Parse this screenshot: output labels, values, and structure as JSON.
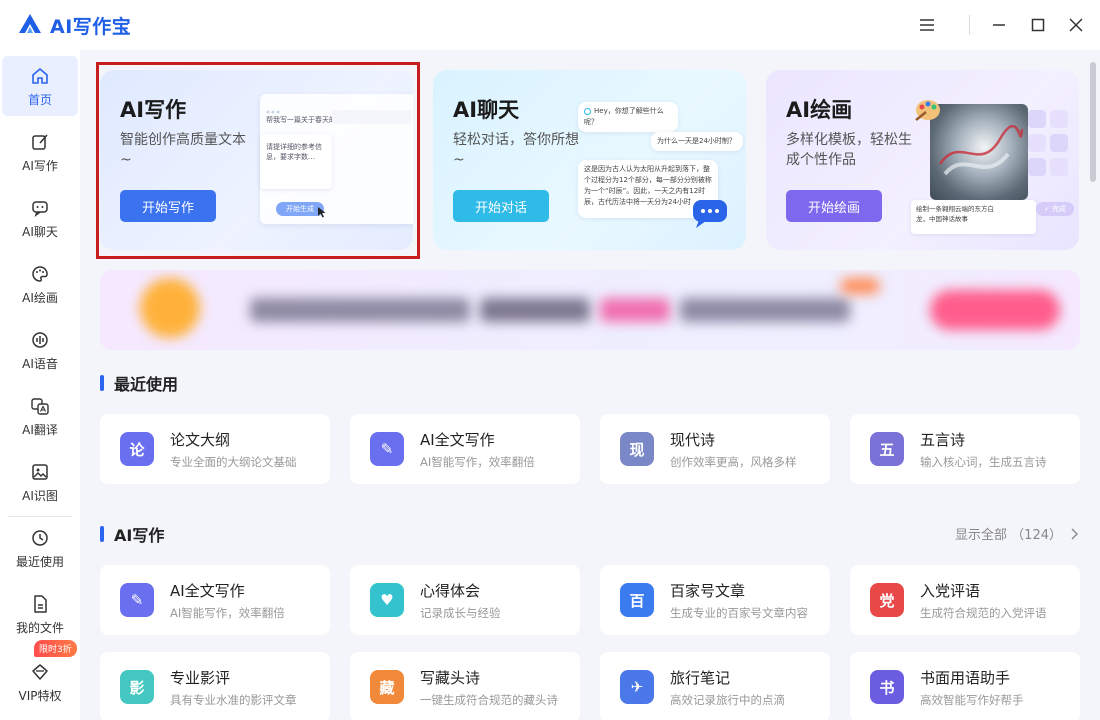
{
  "app": {
    "title": "AI写作宝"
  },
  "window_controls": [
    "menu-icon",
    "minimize-icon",
    "maximize-icon",
    "close-icon"
  ],
  "sidebar": {
    "items": [
      {
        "label": "首页",
        "icon": "home-icon",
        "active": true
      },
      {
        "label": "AI写作",
        "icon": "edit-icon"
      },
      {
        "label": "AI聊天",
        "icon": "chat-icon"
      },
      {
        "label": "AI绘画",
        "icon": "palette-icon"
      },
      {
        "label": "AI语音",
        "icon": "voice-icon"
      },
      {
        "label": "AI翻译",
        "icon": "translate-icon"
      },
      {
        "label": "AI识图",
        "icon": "image-icon"
      },
      {
        "label": "最近使用",
        "icon": "history-icon"
      },
      {
        "label": "我的文件",
        "icon": "file-icon"
      },
      {
        "label": "VIP特权",
        "icon": "vip-icon"
      }
    ],
    "vip_badge": "限时3折"
  },
  "hero": [
    {
      "title": "AI写作",
      "desc": "智能创作高质量文本~",
      "button": "开始写作",
      "preview": {
        "prompt": "帮我写一篇关于春天的作文",
        "body": "请提详细的参考信息，要求字数…",
        "action": "开始生成"
      }
    },
    {
      "title": "AI聊天",
      "desc": "轻松对话，答你所想~",
      "button": "开始对话",
      "preview": {
        "greeting": "Hey，你想了解些什么呢？",
        "question": "为什么一天是24小时制？",
        "answer": "这是因为古人认为太阳从升起到落下，整个过程分为12个部分，每一部分分别被称为一个“时辰”。因此，一天之内有12时辰，古代历法中将一天分为24小时"
      }
    },
    {
      "title": "AI绘画",
      "desc": "多样化模板，轻松生成个性作品",
      "button": "开始绘画",
      "preview": {
        "prompt": "绘制一条翱翔云端的东方白龙，中国神话故事",
        "status": "完成"
      }
    }
  ],
  "recent": {
    "title": "最近使用",
    "tools": [
      {
        "name": "论文大纲",
        "desc": "专业全面的大纲论文基础",
        "icon": "outline-icon",
        "glyph": "论",
        "color": "#6a6ff0"
      },
      {
        "name": "AI全文写作",
        "desc": "AI智能写作，效率翻倍",
        "icon": "quill-icon",
        "glyph": "✎",
        "color": "#6a6ff0"
      },
      {
        "name": "现代诗",
        "desc": "创作效率更高，风格多样",
        "icon": "poem-icon",
        "glyph": "现",
        "color": "#7b88c8"
      },
      {
        "name": "五言诗",
        "desc": "输入核心词，生成五言诗",
        "icon": "poem5-icon",
        "glyph": "五",
        "color": "#7b72d8"
      }
    ]
  },
  "ai_writing": {
    "title": "AI写作",
    "show_all": "显示全部 （124）",
    "tools": [
      {
        "name": "AI全文写作",
        "desc": "AI智能写作，效率翻倍",
        "icon": "quill-icon",
        "glyph": "✎",
        "color": "#6a6ff0"
      },
      {
        "name": "心得体会",
        "desc": "记录成长与经验",
        "icon": "notebook-icon",
        "glyph": "♥",
        "color": "#35c2cf"
      },
      {
        "name": "百家号文章",
        "desc": "生成专业的百家号文章内容",
        "icon": "baijia-icon",
        "glyph": "百",
        "color": "#3a7cf0"
      },
      {
        "name": "入党评语",
        "desc": "生成符合规范的入党评语",
        "icon": "party-icon",
        "glyph": "党",
        "color": "#e94848"
      },
      {
        "name": "专业影评",
        "desc": "具有专业水准的影评文章",
        "icon": "film-icon",
        "glyph": "影",
        "color": "#44c7c0"
      },
      {
        "name": "写藏头诗",
        "desc": "一键生成符合规范的藏头诗",
        "icon": "acrostic-icon",
        "glyph": "藏",
        "color": "#f08a3a"
      },
      {
        "name": "旅行笔记",
        "desc": "高效记录旅行中的点滴",
        "icon": "travel-icon",
        "glyph": "✈",
        "color": "#4a78e8"
      },
      {
        "name": "书面用语助手",
        "desc": "高效智能写作好帮手",
        "icon": "book-icon",
        "glyph": "书",
        "color": "#6b5de0"
      }
    ]
  }
}
